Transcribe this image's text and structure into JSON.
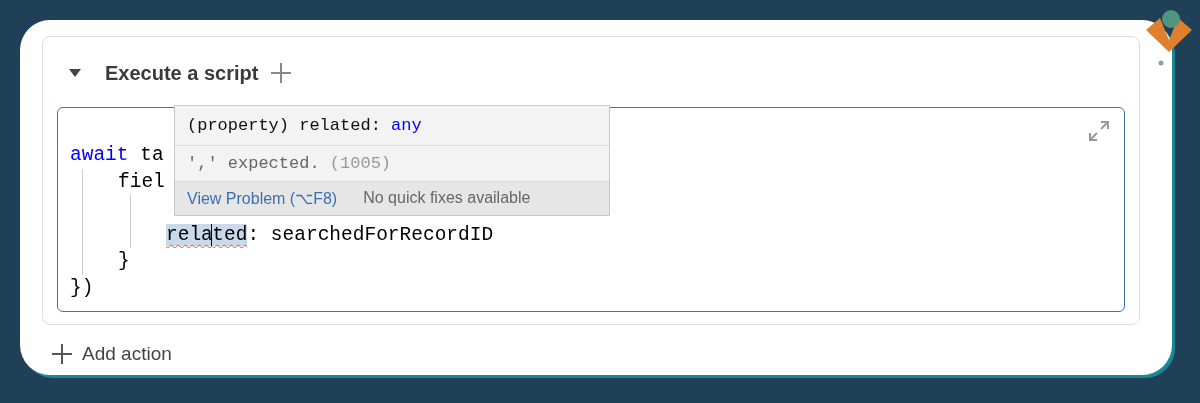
{
  "action": {
    "title": "Execute a script",
    "expanded": true
  },
  "code_lines": [
    {
      "kind": "code",
      "tokens": [
        {
          "text": "await",
          "keyword": true
        },
        {
          "text": " ta"
        }
      ],
      "children": [
        {
          "kind": "code",
          "tokens": [
            {
              "text": "fiel"
            }
          ],
          "children": [
            {
              "kind": "blank"
            },
            {
              "kind": "code",
              "tokens": [
                {
                  "text": "rela",
                  "highlighted": true,
                  "error": true
                },
                {
                  "text": "ted",
                  "highlighted": true,
                  "error": true,
                  "cursor": true
                },
                {
                  "text": ": searchedForRecordID"
                }
              ]
            }
          ]
        },
        {
          "kind": "code",
          "tokens": [
            {
              "text": "}"
            }
          ]
        }
      ]
    },
    {
      "kind": "code",
      "tokens": [
        {
          "text": "})"
        }
      ]
    }
  ],
  "hover": {
    "signature": [
      {
        "text": "(property) related: "
      },
      {
        "text": "any",
        "keyword": true
      }
    ],
    "message": "',' expected.",
    "code": "(1005)",
    "link": "View Problem (⌥F8)",
    "note": "No quick fixes available"
  },
  "add_action": "Add action"
}
